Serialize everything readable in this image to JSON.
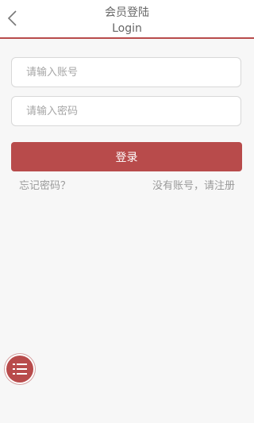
{
  "header": {
    "title_cn": "会员登陆",
    "title_en": "Login",
    "back_icon": "chevron-left-icon"
  },
  "form": {
    "account_placeholder": "请输入账号",
    "account_value": "",
    "password_placeholder": "请输入密码",
    "password_value": "",
    "login_label": "登录"
  },
  "links": {
    "forgot": "忘记密码？",
    "register": "没有账号，请注册"
  },
  "fab": {
    "icon": "list-menu-icon"
  },
  "colors": {
    "accent": "#b84b4b",
    "background": "#f7f7f7",
    "placeholder": "#a6a6a6",
    "link": "#9a9a9a"
  }
}
